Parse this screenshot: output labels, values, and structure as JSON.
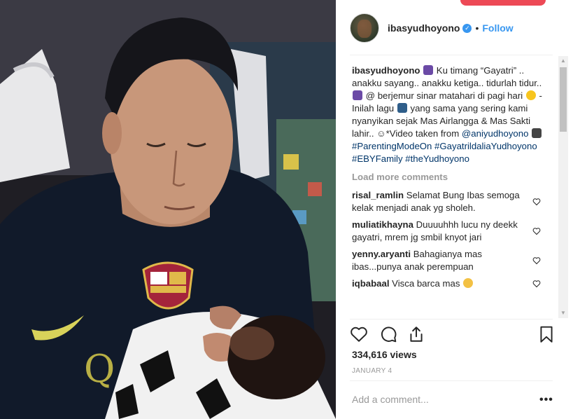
{
  "post": {
    "username": "ibasyudhoyono",
    "verified_icon": "verified-badge-icon",
    "separator": "•",
    "follow_label": "Follow",
    "caption": {
      "part1": "Ku timang “Gayatri” .. anakku sayang.. anakku ketiga.. tidurlah tidur..",
      "part2": "@ berjemur sinar matahari di pagi hari",
      "part3": "- Inilah lagu",
      "part4": "yang sama yang sering kami nyanyikan sejak Mas Airlangga & Mas Sakti lahir.. ☺*Video taken from",
      "mention": "@aniyudhoyono",
      "hashtag1": "#ParentingModeOn",
      "hashtag2": "#GayatrildaliaYudhoyono",
      "hashtag3": "#EBYFamily",
      "hashtag4": "#theYudhoyono"
    },
    "load_more": "Load more comments",
    "comments": [
      {
        "user": "risal_ramlin",
        "text": "Selamat Bung Ibas semoga kelak menjadi anak yg sholeh."
      },
      {
        "user": "muliatikhayna",
        "text": "Duuuuhhh lucu ny deekk gayatri, mrem jg smbil knyot jari"
      },
      {
        "user": "yenny.aryanti",
        "text": "Bahagianya mas ibas...punya anak perempuan"
      },
      {
        "user": "iqbabaal",
        "text": "Visca barca mas"
      }
    ],
    "views": "334,616 views",
    "date": "JANUARY 4",
    "add_comment_placeholder": "Add a comment...",
    "more_options": "•••"
  },
  "icons": {
    "like": "heart-icon",
    "comment": "comment-bubble-icon",
    "share": "share-icon",
    "save": "bookmark-icon",
    "comment_like": "heart-outline-small-icon"
  },
  "colors": {
    "link": "#3897f0",
    "hashtag": "#003569",
    "muted": "#999999",
    "accent_pill": "#ed4956"
  }
}
